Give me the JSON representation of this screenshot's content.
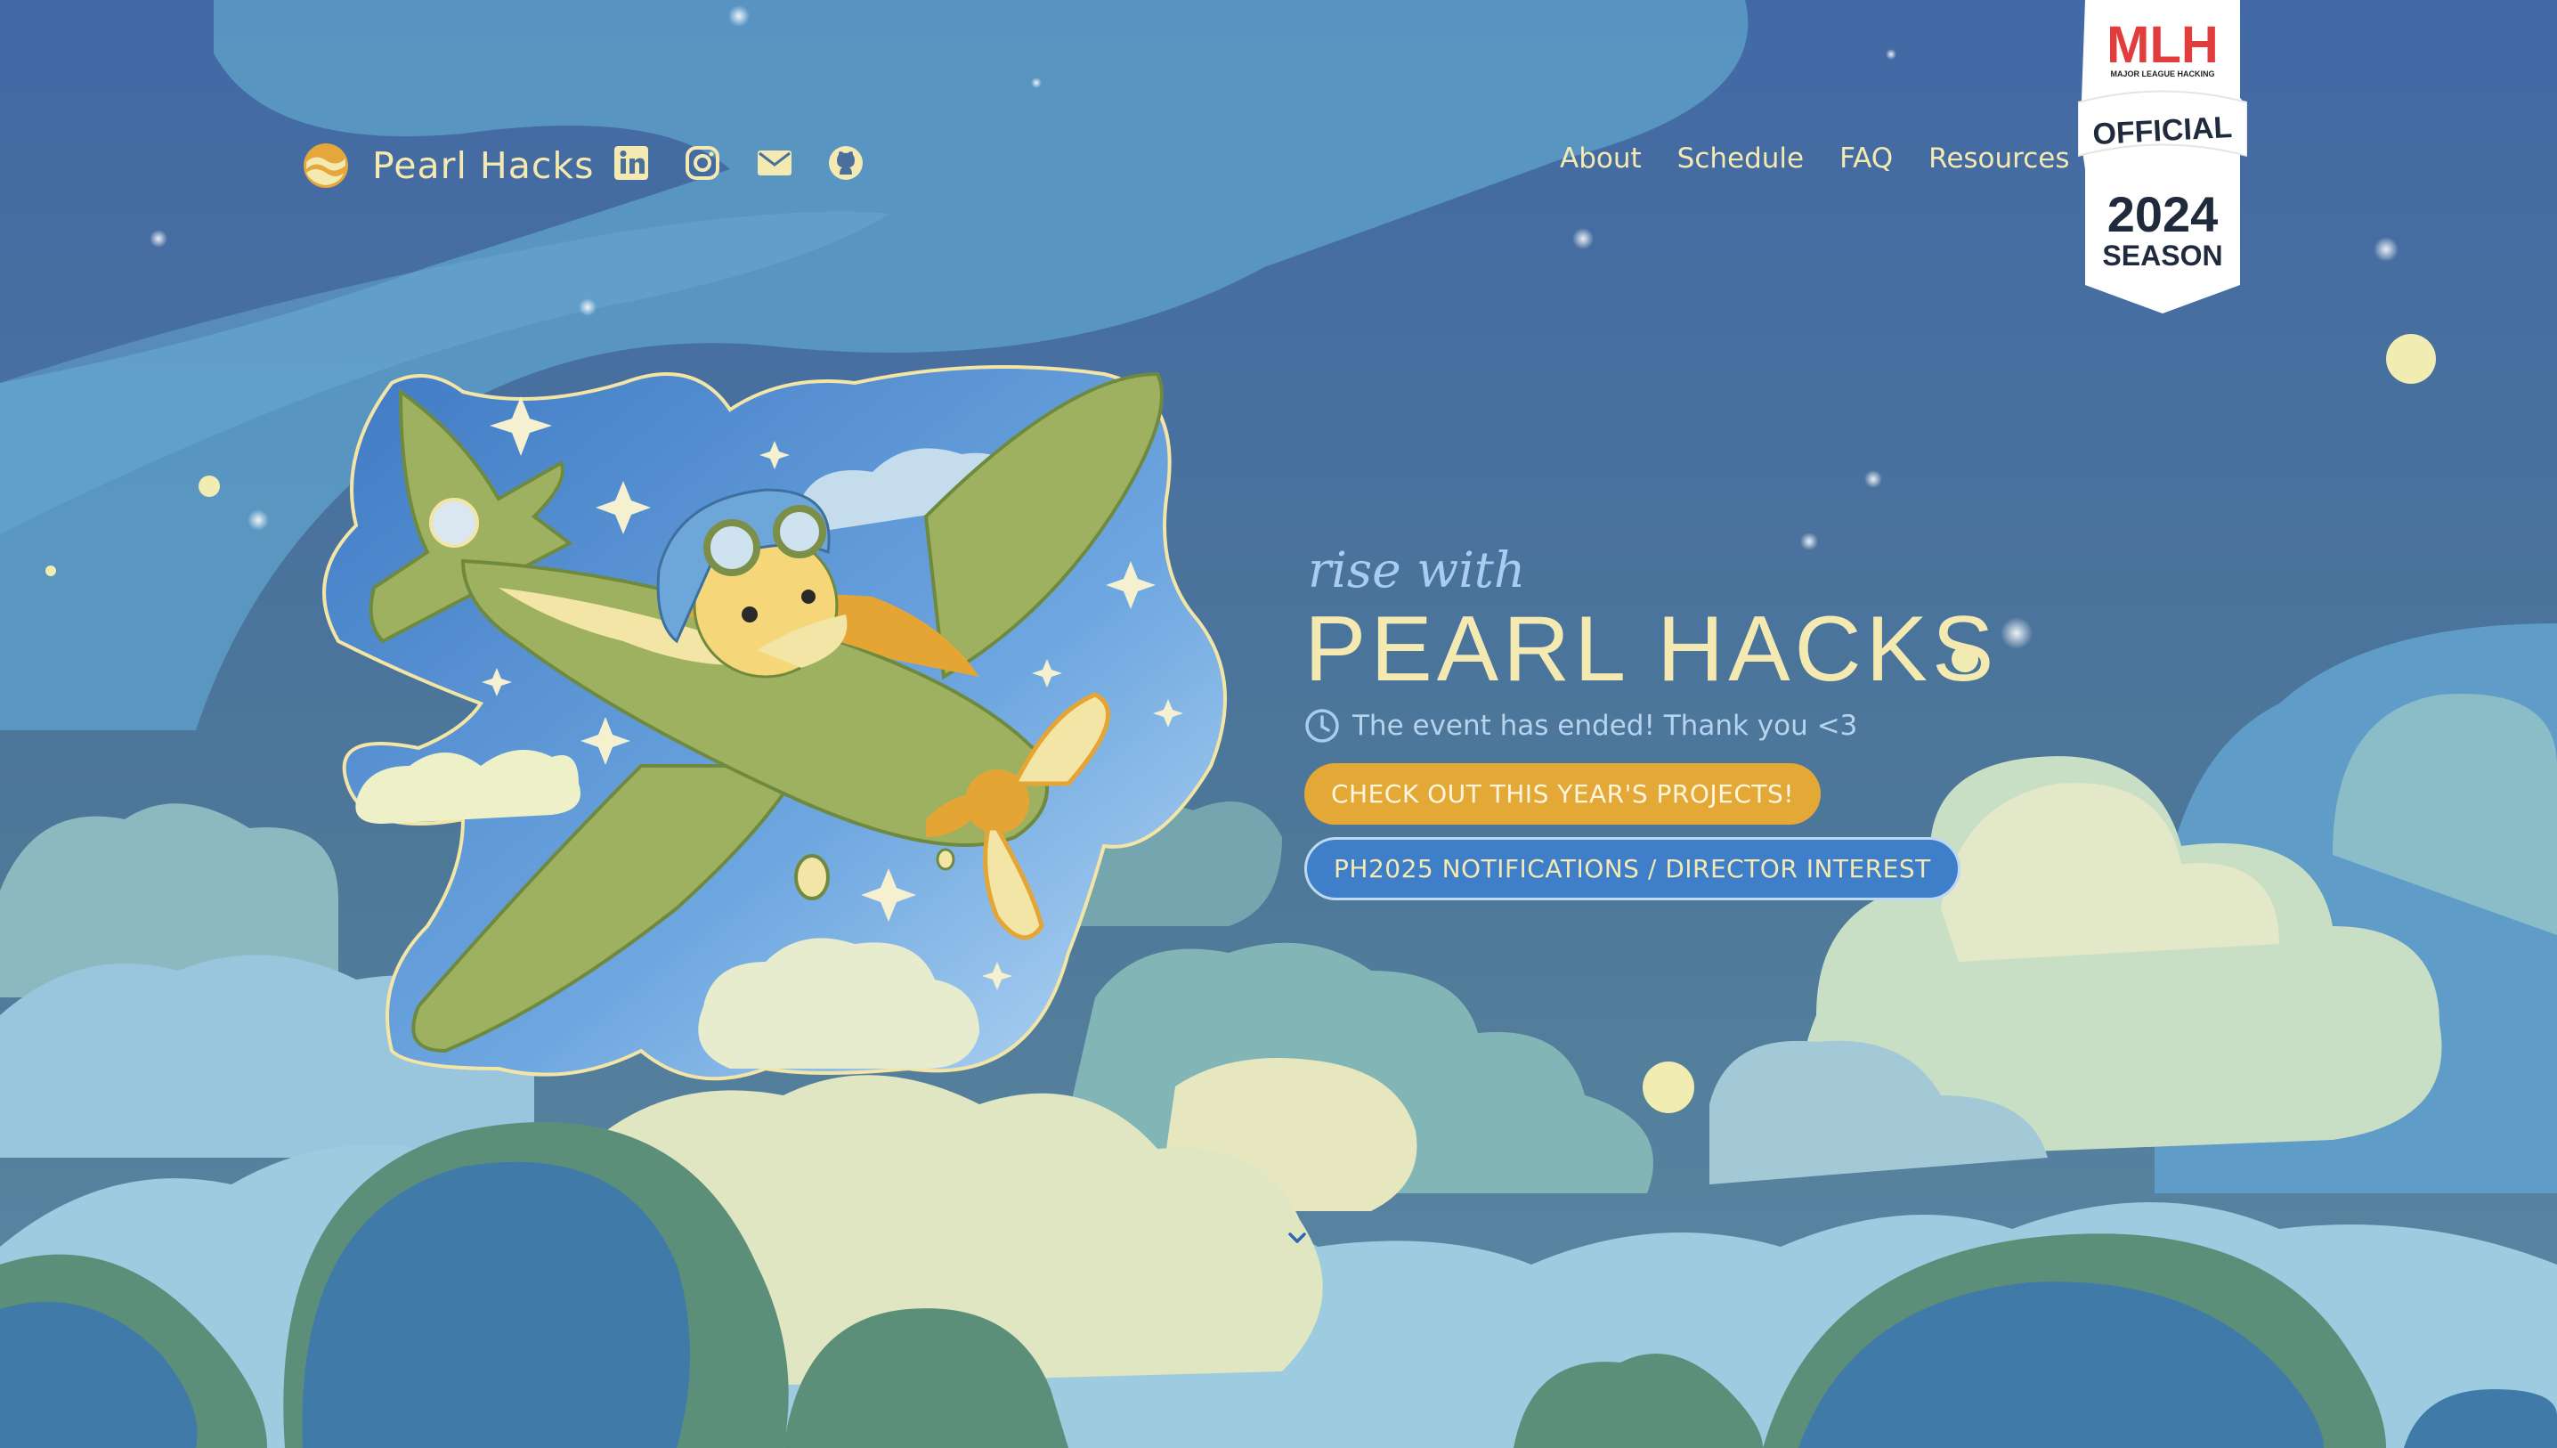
{
  "nav": {
    "brand_name": "Pearl Hacks",
    "social": [
      "linkedin-icon",
      "instagram-icon",
      "mail-icon",
      "github-icon"
    ],
    "links": [
      "About",
      "Schedule",
      "FAQ",
      "Resources"
    ]
  },
  "mlh_badge": {
    "logo": "MLH",
    "subtitle": "MAJOR LEAGUE HACKING",
    "official": "OFFICIAL",
    "year": "2024",
    "season": "SEASON"
  },
  "hero": {
    "tagline": "rise with",
    "title": "PEARL HACKS",
    "status": "The event has ended! Thank you <3",
    "cta_projects": "CHECK OUT THIS YEAR'S PROJECTS!",
    "cta_notifications": "PH2025 NOTIFICATIONS / DIRECTOR INTEREST"
  },
  "colors": {
    "sky_top": "#4269a5",
    "sky_bottom": "#5c8aa4",
    "cream": "#f4eab1",
    "accent_gold": "#e4a836",
    "button_blue": "#3f7fca"
  }
}
